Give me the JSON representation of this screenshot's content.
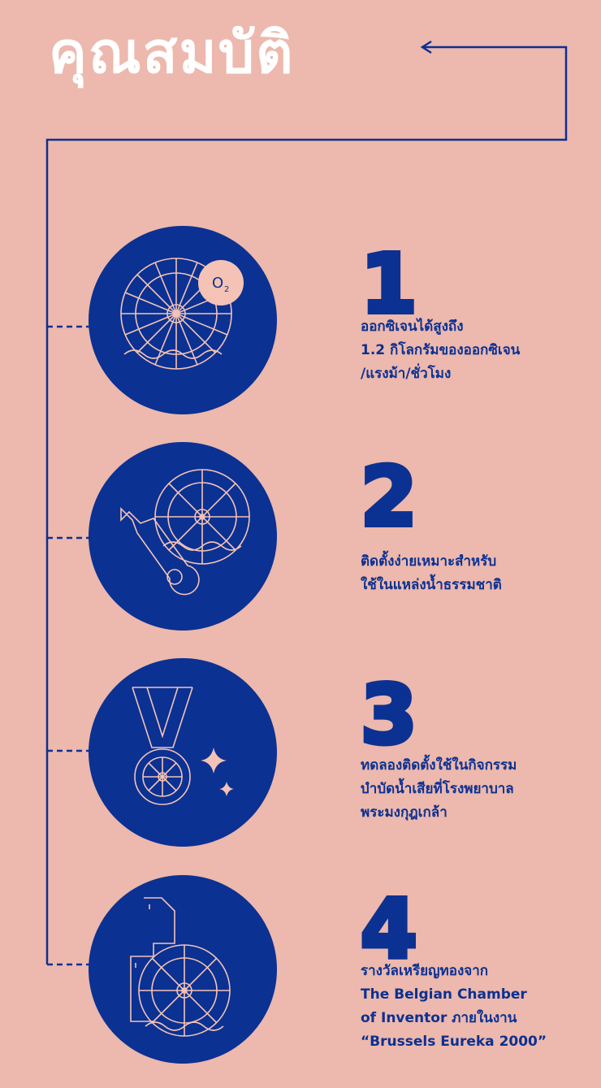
{
  "title": "คุณสมบัติ",
  "items": [
    {
      "number": "1",
      "lines": [
        "ออกซิเจนได้สูงถึง",
        "1.2 กิโลกรัมของออกซิเจน",
        "/แรงม้า/ชั่วโมง"
      ],
      "badge": "O₂",
      "icon": "paddle-wheel-oxygen-icon"
    },
    {
      "number": "2",
      "lines": [
        "ติดตั้งง่ายเหมาะสำหรับ",
        "ใช้ในแหล่งน้ำธรรมชาติ"
      ],
      "icon": "wrench-paddle-wheel-icon"
    },
    {
      "number": "3",
      "lines": [
        "ทดลองติดตั้งใช้ในกิจกรรม",
        "บำบัดน้ำเสียที่โรงพยาบาล",
        "พระมงกุฎเกล้า"
      ],
      "icon": "medal-icon"
    },
    {
      "number": "4",
      "lines": [
        "รางวัลเหรียญทองจาก",
        "The Belgian Chamber",
        "of Inventor ภายในงาน",
        "“Brussels Eureka 2000”"
      ],
      "icon": "factory-paddle-wheel-icon"
    }
  ],
  "colors": {
    "background": "#EDB8AD",
    "accent": "#0B3192",
    "line": "#F4C3B5",
    "title": "#FFFFFF"
  }
}
